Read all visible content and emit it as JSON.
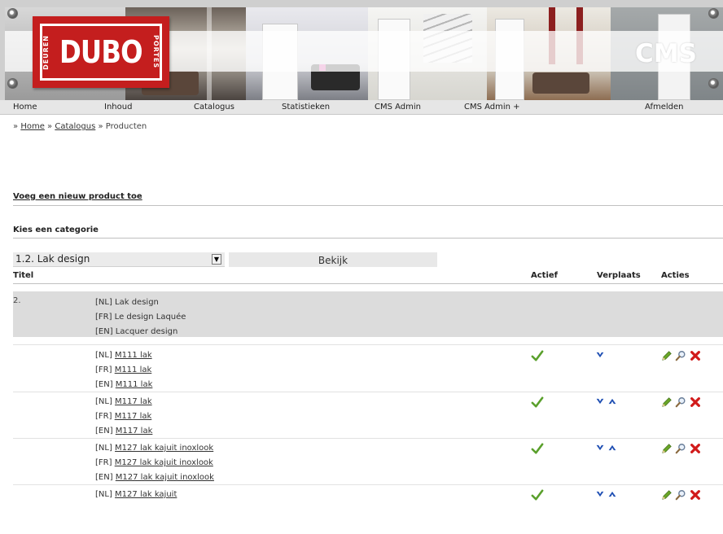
{
  "brand": {
    "logo_main": "DUBO",
    "logo_left": "DEUREN",
    "logo_right": "PORTES",
    "cms_label": "CMS",
    "color_red": "#c41e1e"
  },
  "nav": {
    "items": [
      "Home",
      "Inhoud",
      "Catalogus",
      "Statistieken",
      "CMS Admin",
      "CMS Admin +",
      "Afmelden"
    ]
  },
  "breadcrumb": {
    "sep": "»",
    "home": "Home",
    "catalog": "Catalogus",
    "current": "Producten"
  },
  "actions": {
    "add_product": "Voeg een nieuw product toe",
    "choose_category": "Kies een categorie",
    "category_selected": "1.2. Lak design",
    "view_button": "Bekijk"
  },
  "table": {
    "headers": {
      "title": "Titel",
      "active": "Actief",
      "move": "Verplaats",
      "actions": "Acties"
    },
    "category": {
      "number": "2.",
      "lines": [
        "[NL] Lak design",
        "[FR] Le design Laquée",
        "[EN] Lacquer design"
      ]
    },
    "products": [
      {
        "lines": [
          [
            "[NL]",
            "M111 lak"
          ],
          [
            "[FR]",
            "M111 lak"
          ],
          [
            "[EN]",
            "M111 lak"
          ]
        ],
        "active": true,
        "up": false,
        "down": true
      },
      {
        "lines": [
          [
            "[NL]",
            "M117 lak"
          ],
          [
            "[FR]",
            "M117 lak"
          ],
          [
            "[EN]",
            "M117 lak"
          ]
        ],
        "active": true,
        "up": true,
        "down": true
      },
      {
        "lines": [
          [
            "[NL]",
            "M127 lak kajuit inoxlook"
          ],
          [
            "[FR]",
            "M127 lak kajuit inoxlook"
          ],
          [
            "[EN]",
            "M127 lak kajuit inoxlook"
          ]
        ],
        "active": true,
        "up": true,
        "down": true
      },
      {
        "lines": [
          [
            "[NL]",
            "M127 lak kajuit"
          ]
        ],
        "active": true,
        "up": true,
        "down": true
      }
    ],
    "icons": {
      "active": "check-icon",
      "down": "arrow-down-icon",
      "up": "arrow-up-icon",
      "edit": "pencil-icon",
      "view": "magnifier-icon",
      "delete": "delete-x-icon"
    },
    "colors": {
      "check": "#5aa02c",
      "arrow": "#1f4fb3",
      "delete": "#d11a1a",
      "pencil": "#6aa628"
    }
  }
}
